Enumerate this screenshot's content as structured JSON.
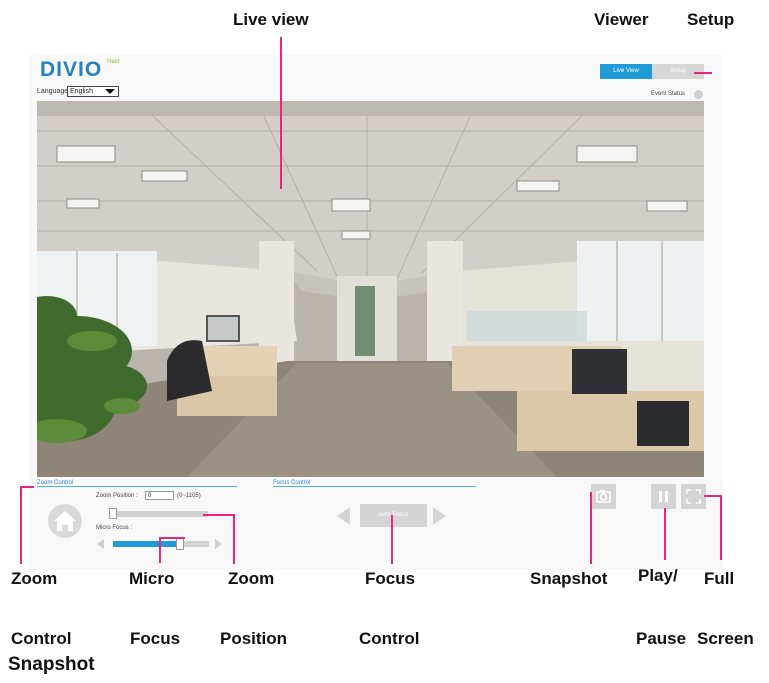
{
  "callouts": {
    "live_view": "Live view",
    "viewer": "Viewer",
    "setup": "Setup",
    "zoom": "Zoom",
    "control_1": "Control",
    "micro": "Micro",
    "focus_1": "Focus",
    "zoom_2": "Zoom",
    "position": "Position",
    "focus_2": "Focus",
    "control_2": "Control",
    "snapshot_1": "Snapshot",
    "play": "Play/",
    "pause": "Pause",
    "full": "Full",
    "screen": "Screen",
    "snapshot_2": "Snapshot"
  },
  "header": {
    "logo": "DIVIO",
    "logo_sup": "Next",
    "language_label": "Language:",
    "language_value": "English",
    "tabs": [
      {
        "label": "Live View",
        "active": true
      },
      {
        "label": "Setup",
        "active": false
      }
    ],
    "event_status": "Event Status"
  },
  "zoom_control": {
    "title": "Zoom Control",
    "position_label": "Zoom Position :",
    "position_value": "0",
    "range": "(0~1105)",
    "zoom_level": 0,
    "micro_focus_label": "Micro Focus :",
    "micro_focus_level": 0.7
  },
  "focus_control": {
    "title": "Focus Control",
    "auto_focus": "Auto Focus"
  },
  "colors": {
    "accent": "#1f9ad6",
    "pointer": "#e8267b",
    "disabled": "#d4d4d4"
  },
  "icons": [
    "home-icon",
    "camera-icon",
    "pause-icon",
    "fullscreen-icon",
    "arrow-left-icon",
    "arrow-right-icon",
    "dropdown-caret-icon"
  ]
}
